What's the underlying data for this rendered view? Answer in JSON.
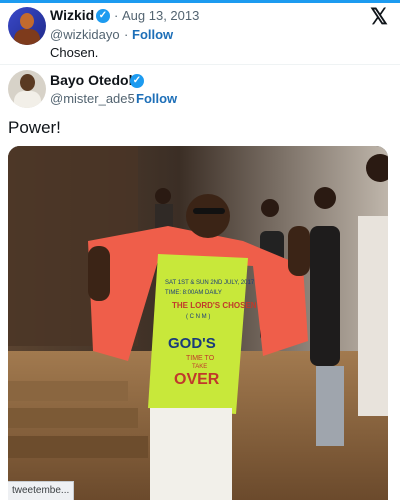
{
  "quoted_tweet": {
    "author_name": "Wizkid",
    "handle": "@wizkidayo",
    "date": "Aug 13, 2013",
    "follow_label": "Follow",
    "text": "Chosen.",
    "separator": "·"
  },
  "tweet": {
    "author_name": "Bayo Otedola",
    "handle": "@mister_ade5",
    "follow_label": "Follow",
    "text": "Power!"
  },
  "icons": {
    "verified": "verified-badge-icon",
    "x_logo": "x-logo-icon",
    "verified_glyph": "✓",
    "x_glyph": "𝕏"
  },
  "colors": {
    "accent": "#1d9bf0",
    "follow_link": "#1d6fb8",
    "muted": "#536471",
    "shirt_green": "#c8e83a",
    "jacket_coral": "#ef5e4a"
  },
  "photo_poster": {
    "line1": "SAT 1ST & SUN 2ND JULY, 2017",
    "line2": "TIME: 8:00AM DAILY",
    "line3": "THE LORD'S CHOSEN",
    "line4": "( C N M )",
    "line5": "GOD'S",
    "line6": "TIME TO",
    "line7": "TAKE",
    "line8": "OVER"
  },
  "statusbar": {
    "text": "tweetembe..."
  }
}
